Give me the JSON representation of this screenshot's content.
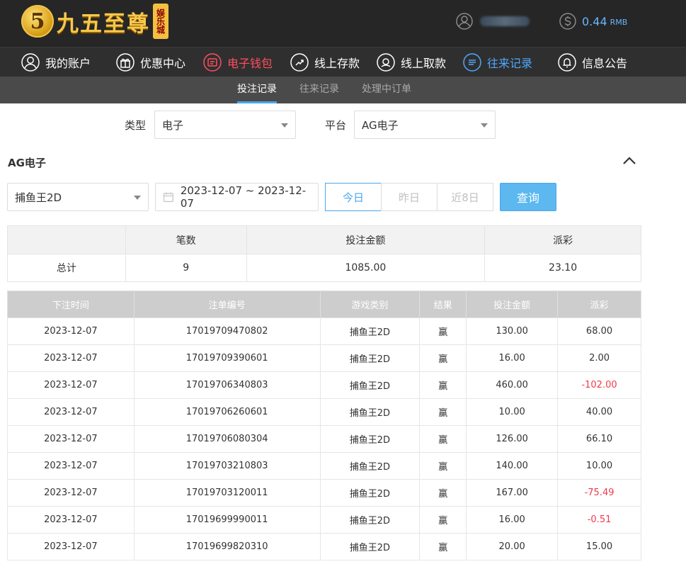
{
  "header": {
    "logo_digit": "5",
    "logo_text": "九五至尊",
    "logo_badge": "娱乐城",
    "balance_amount": "0.44",
    "balance_unit": "RMB"
  },
  "nav": {
    "items": [
      {
        "label": "我的账户",
        "icon": "user-icon"
      },
      {
        "label": "优惠中心",
        "icon": "gift-icon"
      },
      {
        "label": "电子钱包",
        "icon": "wallet-icon"
      },
      {
        "label": "线上存款",
        "icon": "deposit-icon"
      },
      {
        "label": "线上取款",
        "icon": "withdraw-icon"
      },
      {
        "label": "往来记录",
        "icon": "records-icon"
      },
      {
        "label": "信息公告",
        "icon": "bell-icon"
      }
    ]
  },
  "subnav": {
    "tabs": [
      "投注记录",
      "往来记录",
      "处理中订单"
    ]
  },
  "filters": {
    "type_label": "类型",
    "type_value": "电子",
    "platform_label": "平台",
    "platform_value": "AG电子"
  },
  "section": {
    "title": "AG电子",
    "game_value": "捕鱼王2D",
    "date_range": "2023-12-07 ~ 2023-12-07",
    "range_buttons": [
      "今日",
      "昨日",
      "近8日"
    ],
    "query_label": "查询"
  },
  "summary": {
    "headers": [
      "",
      "笔数",
      "投注金额",
      "派彩"
    ],
    "row": [
      "总计",
      "9",
      "1085.00",
      "23.10"
    ]
  },
  "details": {
    "headers": [
      "下注时间",
      "注单编号",
      "游戏类别",
      "结果",
      "投注金额",
      "派彩"
    ],
    "rows": [
      [
        "2023-12-07",
        "17019709470802",
        "捕鱼王2D",
        "赢",
        "130.00",
        "68.00"
      ],
      [
        "2023-12-07",
        "17019709390601",
        "捕鱼王2D",
        "赢",
        "16.00",
        "2.00"
      ],
      [
        "2023-12-07",
        "17019706340803",
        "捕鱼王2D",
        "赢",
        "460.00",
        "-102.00"
      ],
      [
        "2023-12-07",
        "17019706260601",
        "捕鱼王2D",
        "赢",
        "10.00",
        "40.00"
      ],
      [
        "2023-12-07",
        "17019706080304",
        "捕鱼王2D",
        "赢",
        "126.00",
        "66.10"
      ],
      [
        "2023-12-07",
        "17019703210803",
        "捕鱼王2D",
        "赢",
        "140.00",
        "10.00"
      ],
      [
        "2023-12-07",
        "17019703120011",
        "捕鱼王2D",
        "赢",
        "167.00",
        "-75.49"
      ],
      [
        "2023-12-07",
        "17019699990011",
        "捕鱼王2D",
        "赢",
        "16.00",
        "-0.51"
      ],
      [
        "2023-12-07",
        "17019699820310",
        "捕鱼王2D",
        "赢",
        "20.00",
        "15.00"
      ]
    ]
  },
  "colors": {
    "accent_blue": "#4aa6ee",
    "negative_red": "#ee3b4b",
    "nav_red": "#ff4e5d"
  }
}
